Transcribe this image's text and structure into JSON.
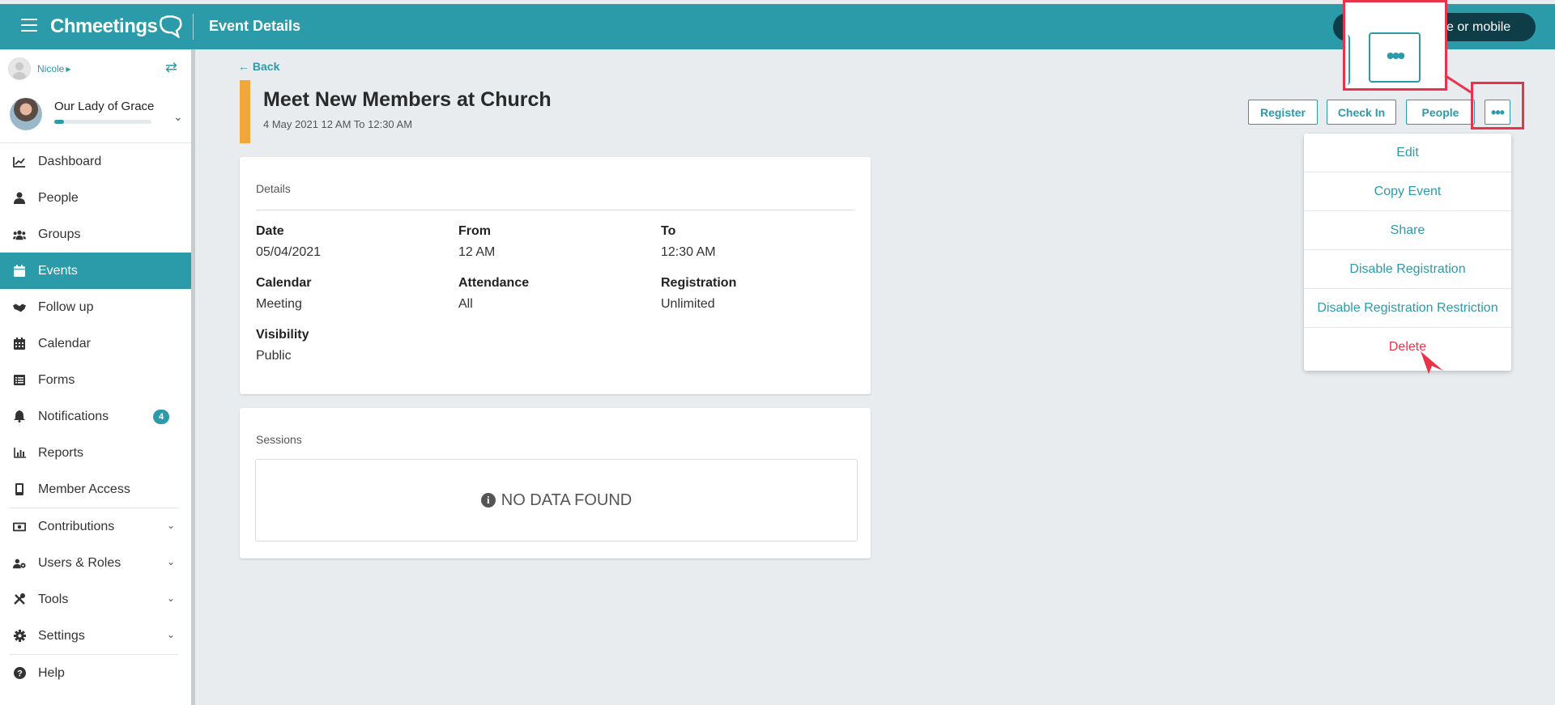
{
  "topbar": {
    "menu_icon": "hamburger-icon",
    "logo_text": "Chmeetings",
    "page_title": "Event Details",
    "search_placeholder_visible": "e or mobile"
  },
  "sidebar": {
    "user_name": "Nicole",
    "org_name": "Our Lady of Grace",
    "org_progress": 0.1,
    "items": [
      {
        "label": "Dashboard",
        "icon": "chart-line-icon"
      },
      {
        "label": "People",
        "icon": "user-icon"
      },
      {
        "label": "Groups",
        "icon": "users-icon"
      },
      {
        "label": "Events",
        "icon": "calendar-icon",
        "active": true
      },
      {
        "label": "Follow up",
        "icon": "handshake-icon"
      },
      {
        "label": "Calendar",
        "icon": "calendar-grid-icon"
      },
      {
        "label": "Forms",
        "icon": "list-icon"
      },
      {
        "label": "Notifications",
        "icon": "bell-icon",
        "badge": "4"
      },
      {
        "label": "Reports",
        "icon": "bar-chart-icon"
      },
      {
        "label": "Member Access",
        "icon": "mobile-icon"
      },
      {
        "label": "Contributions",
        "icon": "money-icon",
        "expandable": true
      },
      {
        "label": "Users & Roles",
        "icon": "users-cog-icon",
        "expandable": true
      },
      {
        "label": "Tools",
        "icon": "tools-icon",
        "expandable": true
      },
      {
        "label": "Settings",
        "icon": "gear-icon",
        "expandable": true
      },
      {
        "label": "Help",
        "icon": "question-circle-icon"
      }
    ]
  },
  "event": {
    "back_label": "Back",
    "title": "Meet New Members at Church",
    "subtitle": "4 May 2021 12 AM To 12:30 AM",
    "accent_color": "#f0a83c"
  },
  "actions": {
    "register": "Register",
    "check_in": "Check In",
    "people": "People",
    "more": "•••"
  },
  "details": {
    "heading": "Details",
    "fields": [
      {
        "label": "Date",
        "value": "05/04/2021"
      },
      {
        "label": "From",
        "value": "12 AM"
      },
      {
        "label": "To",
        "value": "12:30 AM"
      },
      {
        "label": "Calendar",
        "value": "Meeting"
      },
      {
        "label": "Attendance",
        "value": "All"
      },
      {
        "label": "Registration",
        "value": "Unlimited"
      },
      {
        "label": "Visibility",
        "value": "Public"
      }
    ]
  },
  "sessions": {
    "heading": "Sessions",
    "empty_text": "NO DATA FOUND"
  },
  "dropdown": {
    "items": [
      "Edit",
      "Copy Event",
      "Share",
      "Disable Registration",
      "Disable Registration Restriction",
      "Delete"
    ]
  },
  "annotation": {
    "zoom_label": "•••",
    "highlight_color": "#e8334a"
  },
  "colors": {
    "brand": "#2b9ba9",
    "danger": "#e8334a",
    "background": "#e8ecee"
  }
}
